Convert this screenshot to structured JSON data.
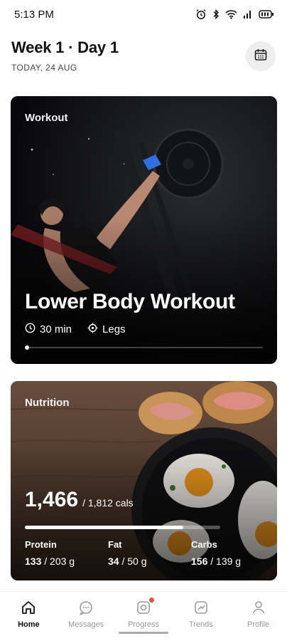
{
  "status_bar": {
    "time": "5:13 PM",
    "icons": [
      "alarm-icon",
      "bluetooth-icon",
      "wifi-icon",
      "signal-icon",
      "battery-icon"
    ]
  },
  "header": {
    "title": "Week 1 · Day 1",
    "date": "TODAY, 24 AUG",
    "calendar_icon": "calendar-icon"
  },
  "workout_card": {
    "label": "Workout",
    "title": "Lower Body Workout",
    "duration": "30 min",
    "focus": "Legs",
    "duration_icon": "clock-icon",
    "focus_icon": "target-icon",
    "progress": 0
  },
  "nutrition_card": {
    "label": "Nutrition",
    "calories": "1,466",
    "calories_total": "/ 1,812 cals",
    "calories_fraction": 0.81,
    "macros": [
      {
        "name": "Protein",
        "value": "133",
        "total": "/ 203 g"
      },
      {
        "name": "Fat",
        "value": "34",
        "total": "/ 50 g"
      },
      {
        "name": "Carbs",
        "value": "156",
        "total": "/ 139 g"
      }
    ]
  },
  "nav": {
    "items": [
      {
        "label": "Home",
        "icon": "home-icon",
        "active": true
      },
      {
        "label": "Messages",
        "icon": "chat-icon",
        "active": false
      },
      {
        "label": "Progress",
        "icon": "progress-icon",
        "active": false
      },
      {
        "label": "Trends",
        "icon": "trends-icon",
        "active": false
      },
      {
        "label": "Profile",
        "icon": "profile-icon",
        "active": false
      }
    ]
  },
  "colors": {
    "accent_dot": "#e5533c",
    "text_primary": "#111111",
    "text_muted": "#9a9a9a"
  }
}
